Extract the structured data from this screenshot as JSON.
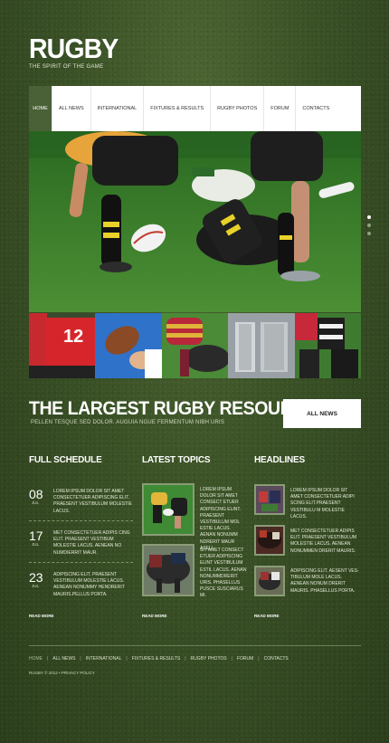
{
  "logo": {
    "title": "RUGBY",
    "tagline": "THE SPIRIT OF THE GAME"
  },
  "nav": {
    "items": [
      {
        "label": "HOME"
      },
      {
        "label": "ALL NEWS"
      },
      {
        "label": "INTERNATIONAL"
      },
      {
        "label": "FIXTURES & RESULTS"
      },
      {
        "label": "RUGBY PHOTOS"
      },
      {
        "label": "FORUM"
      },
      {
        "label": "CONTACTS"
      }
    ]
  },
  "thumbs": {
    "jersey_number": "12"
  },
  "promo": {
    "title": "THE LARGEST RUGBY RESOURCE",
    "subtitle": "PELLEN TESQUE SED DOLOR. AUGUIA NGUE FERMENTUM NIBH URIS",
    "button": "ALL NEWS"
  },
  "schedule": {
    "title": "FULL SCHEDULE",
    "items": [
      {
        "day": "08",
        "month": "JUL",
        "text": "LOREM IPSUM DOLOR SIT AMET CONSECTETUER ADIPISCING ELIT. PRAESENT VESTIBULUM MOLESTIE LACUS."
      },
      {
        "day": "17",
        "month": "JUL",
        "text": "MET CONSECTETUER ADIPIS CING ELIT. PRAESENT VESTIBUM MOLESTIE LACUS. AENEAN NO NUMDIERRIT MAUR."
      },
      {
        "day": "23",
        "month": "JUL",
        "text": "ADIPISCING ELIT. PRAESENT VESTIBULUM MOLESTIE LACUS. AENEAN NONUMMY HENDRERIT MAURIS.PELLUS PORTA."
      }
    ],
    "read_more": "READ MORE"
  },
  "topics": {
    "title": "LATEST TOPICS",
    "items": [
      {
        "text": "LOREM IPSUM DOLOR SIT AMET CONSECT ETUER ADIPISCING ELINT. PRAESENT VESTIBULUM MOL ESTIE LACUS. AENAN NONUMM NDRERIT MAUR ASELL"
      },
      {
        "text": "SIT AMET CONSECT ETUER ADIPISCING ELINT VESTIBULUM ESTIL LACUS. AENAN NONUMMDRERIT URIS. PHASELLUS PUSCE SUSCIARUS MI."
      }
    ],
    "read_more": "READ MORE"
  },
  "headlines": {
    "title": "HEADLINES",
    "items": [
      {
        "text": "LOREM IPSUM DOLOR SIT AMET CONSECTETUER ADIPI SCING ELIT.PRAESENT VESTIBULU M MOLESTIE LACUS."
      },
      {
        "text": "MET CONSECTETUER ADIPIS ELIT. PRAESENT VESTIBULUM MOLESTIE LACUS. AENEAN NONUMMEN DRERIT MAURIS."
      },
      {
        "text": "ADIPISCING ELIT. AESENT VES- TIBULUM MOLE LACUS. AENEAN NONUM DRERIT MAURIS. PHASELLUS PORTA."
      }
    ],
    "read_more": "READ MORE"
  },
  "footer": {
    "nav": [
      "HOME",
      "ALL NEWS",
      "INTERNATIONAL",
      "FIXTURES & RESULTS",
      "RUGBY PHOTOS",
      "FORUM",
      "CONTACTS"
    ],
    "separator": "|",
    "copyright": "RUGBY © 2012 • PRIVACY POLICY"
  }
}
